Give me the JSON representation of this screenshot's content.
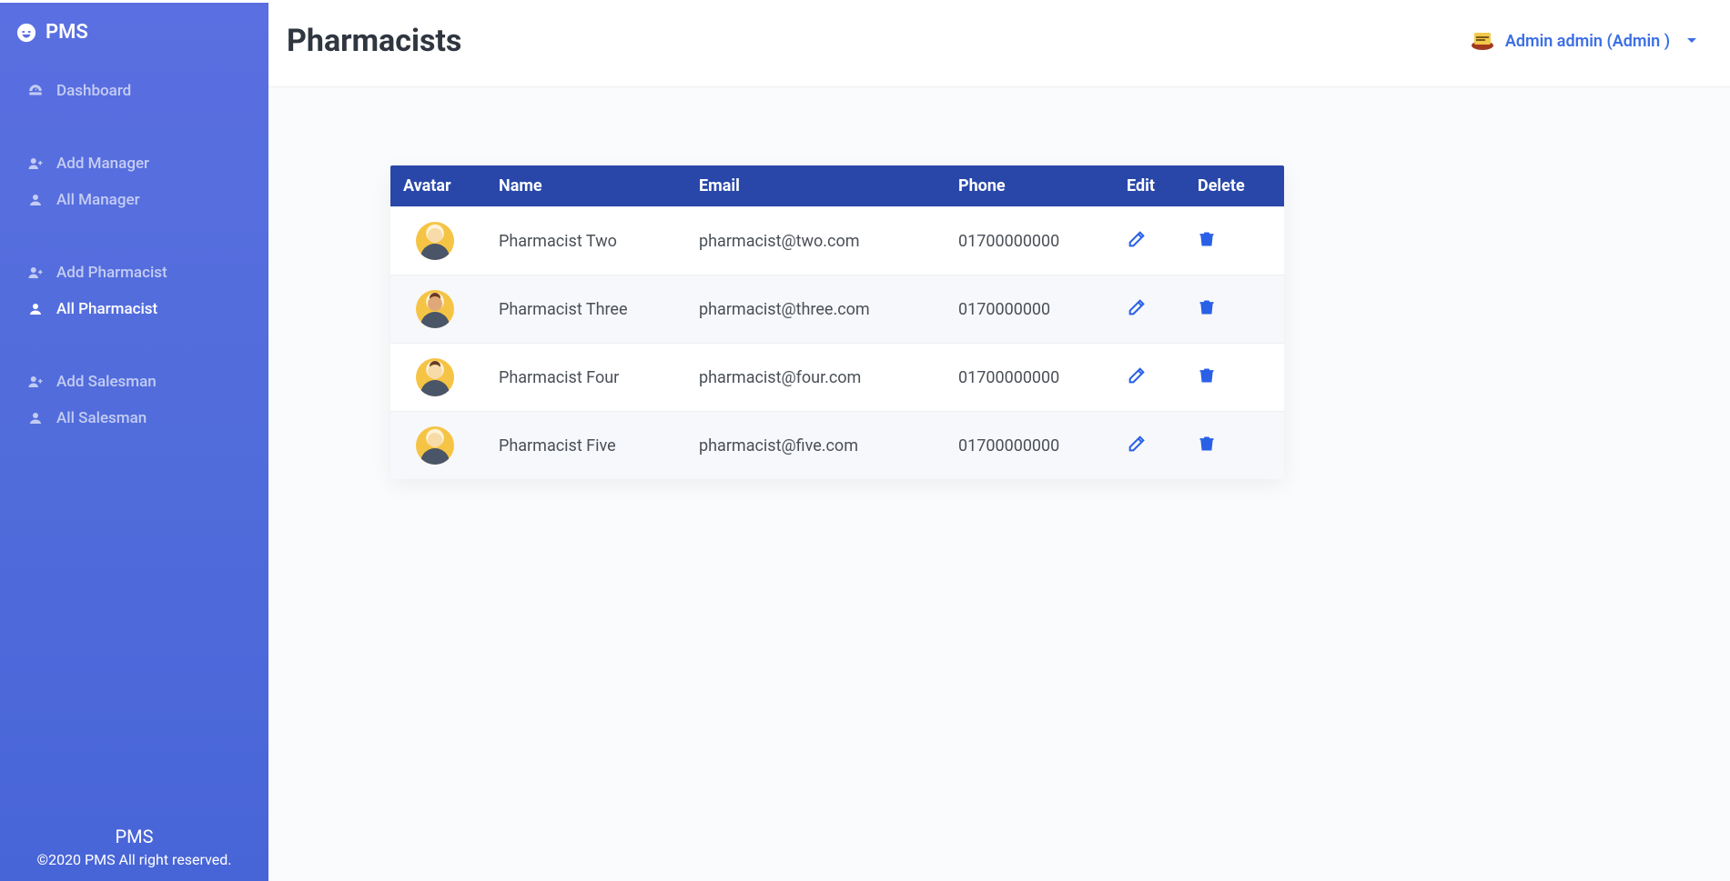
{
  "brand": {
    "name": "PMS"
  },
  "sidebar": {
    "items": [
      {
        "label": "Dashboard",
        "icon": "dashboard-icon",
        "active": false
      },
      {
        "label": "Add Manager",
        "icon": "user-plus-icon",
        "active": false
      },
      {
        "label": "All Manager",
        "icon": "user-icon",
        "active": false
      },
      {
        "label": "Add Pharmacist",
        "icon": "user-plus-icon",
        "active": false
      },
      {
        "label": "All Pharmacist",
        "icon": "user-icon",
        "active": true
      },
      {
        "label": "Add Salesman",
        "icon": "user-plus-icon",
        "active": false
      },
      {
        "label": "All Salesman",
        "icon": "user-icon",
        "active": false
      }
    ],
    "footer": {
      "name": "PMS",
      "copyright": "©2020 PMS All right reserved."
    }
  },
  "header": {
    "title": "Pharmacists",
    "user_label": "Admin admin (Admin )"
  },
  "table": {
    "headers": {
      "avatar": "Avatar",
      "name": "Name",
      "email": "Email",
      "phone": "Phone",
      "edit": "Edit",
      "delete": "Delete"
    },
    "rows": [
      {
        "name": "Pharmacist Two",
        "email": "pharmacist@two.com",
        "phone": "01700000000"
      },
      {
        "name": "Pharmacist Three",
        "email": "pharmacist@three.com",
        "phone": "0170000000"
      },
      {
        "name": "Pharmacist Four",
        "email": "pharmacist@four.com",
        "phone": "01700000000"
      },
      {
        "name": "Pharmacist Five",
        "email": "pharmacist@five.com",
        "phone": "01700000000"
      }
    ]
  }
}
